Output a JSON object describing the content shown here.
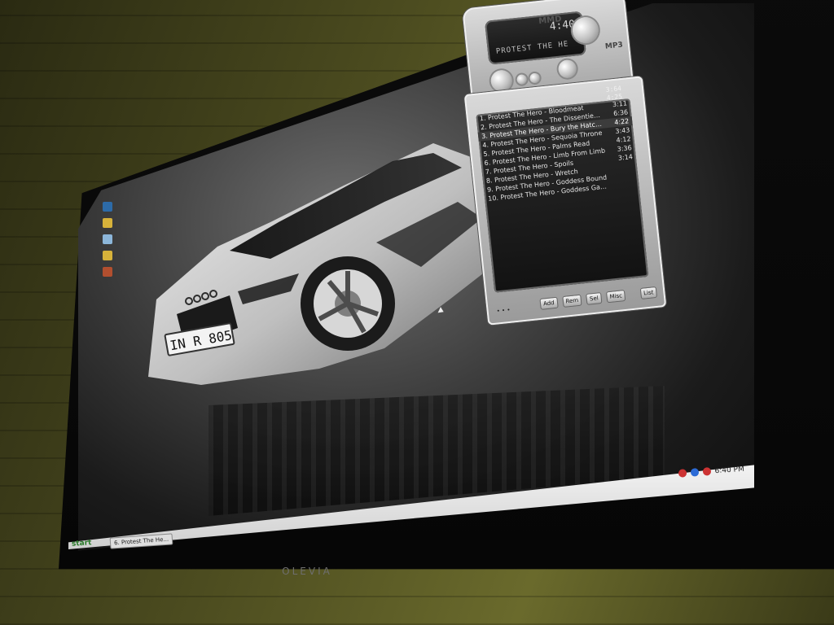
{
  "monitor": {
    "brand": "OLEVIA"
  },
  "desktop": {
    "wallpaper": {
      "subject": "car",
      "license_plate": "IN R 805"
    },
    "icons": [
      {
        "icon": "computer-icon"
      },
      {
        "icon": "folder-icon"
      },
      {
        "icon": "recycle-bin-icon"
      },
      {
        "icon": "folder-icon"
      },
      {
        "icon": "app-icon"
      }
    ]
  },
  "winamp": {
    "logo": "MMD",
    "logo_mp3": "MP3",
    "time": "4:40",
    "track_display": "PROTEST THE HE",
    "playlist": {
      "tracks": [
        {
          "num": "1.",
          "title": "Protest The Hero - Bloodmeat",
          "time": "3:11"
        },
        {
          "num": "2.",
          "title": "Protest The Hero - The Dissentience",
          "time": "6:36"
        },
        {
          "num": "3.",
          "title": "Protest The Hero - Bury the Hatchet",
          "time": "4:22"
        },
        {
          "num": "4.",
          "title": "Protest The Hero - Sequoia Throne",
          "time": "3:43"
        },
        {
          "num": "5.",
          "title": "Protest The Hero - Palms Read",
          "time": "4:12"
        },
        {
          "num": "6.",
          "title": "Protest The Hero - Limb From Limb",
          "time": "3:36"
        },
        {
          "num": "7.",
          "title": "Protest The Hero - Spoils",
          "time": "3:14"
        },
        {
          "num": "8.",
          "title": "Protest The Hero - Wretch",
          "time": ""
        },
        {
          "num": "9.",
          "title": "Protest The Hero - Goddess Bound",
          "time": ""
        },
        {
          "num": "10.",
          "title": "Protest The Hero - Goddess Gagged",
          "time": ""
        }
      ],
      "top_times": [
        "3:64",
        "4:25"
      ],
      "buttons": [
        "Add",
        "Rem",
        "Sel",
        "Misc"
      ],
      "footer_right": "List"
    }
  },
  "taskbar": {
    "start_label": "start",
    "task_label": "6. Protest The He...",
    "clock": "6:40 PM"
  },
  "colors": {
    "wall": "#4d4d20",
    "tv_bezel": "#0b0b0b",
    "taskbar": "#e6e6e6",
    "winamp_chrome": "#cfcfcf"
  }
}
